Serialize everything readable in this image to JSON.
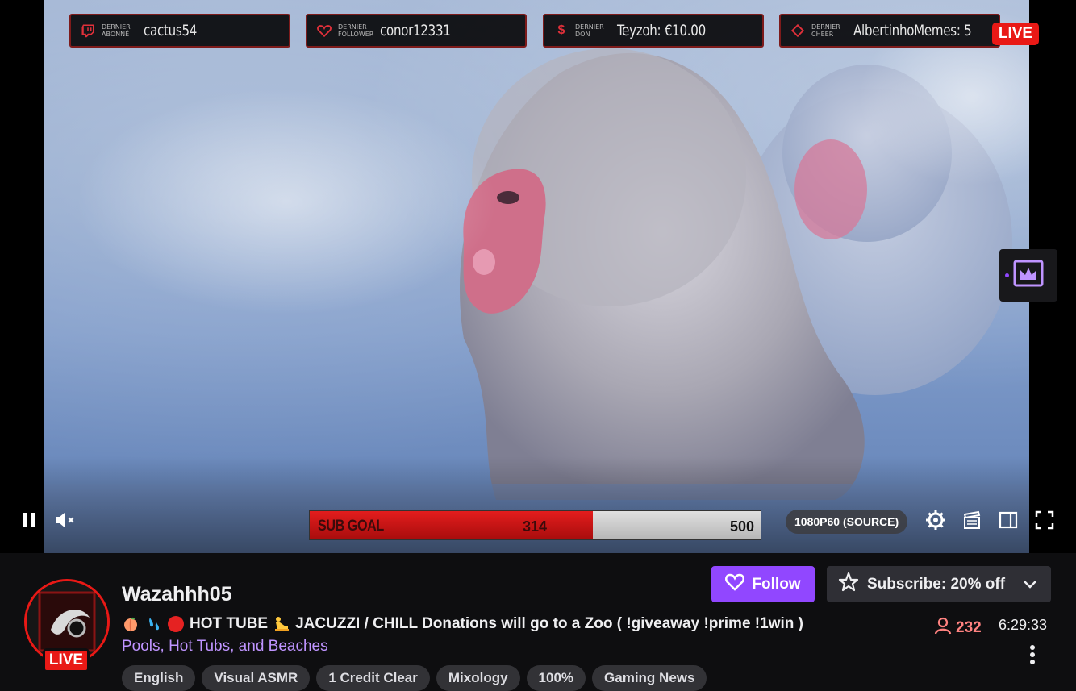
{
  "alerts": [
    {
      "label_line1": "DERNIER",
      "label_line2": "ABONNÉ",
      "value": "cactus54",
      "icon": "twitch-icon"
    },
    {
      "label_line1": "DERNIER",
      "label_line2": "FOLLOWER",
      "value": "conor12331",
      "icon": "heart-icon"
    },
    {
      "label_line1": "DERNIER",
      "label_line2": "DON",
      "value": "Teyzoh: €10.00",
      "icon": "dollar-icon"
    },
    {
      "label_line1": "DERNIER",
      "label_line2": "CHEER",
      "value": "AlbertinhoMemes: 5",
      "icon": "diamond-icon"
    }
  ],
  "player": {
    "live_label": "LIVE",
    "quality": "1080P60 (SOURCE)",
    "sub_goal": {
      "label": "SUB GOAL",
      "current": "314",
      "target": "500",
      "progress_fraction": 0.628
    }
  },
  "channel": {
    "name": "Wazahhh05",
    "live_badge": "LIVE",
    "title": "HOT TUBE",
    "title_rest": "JACUZZI / CHILL Donations will go to a Zoo ( !giveaway !prime !1win )",
    "category": "Pools, Hot Tubs, and Beaches",
    "tags": [
      "English",
      "Visual ASMR",
      "1 Credit Clear",
      "Mixology",
      "100%",
      "Gaming News"
    ],
    "viewers": "232",
    "uptime": "6:29:33"
  },
  "actions": {
    "follow_label": "Follow",
    "subscribe_label": "Subscribe: 20% off"
  },
  "colors": {
    "twitch_purple": "#9147ff",
    "live_red": "#e91916",
    "viewer_red": "#ff8280",
    "category_purple": "#bf94ff",
    "background": "#0e0e10"
  }
}
